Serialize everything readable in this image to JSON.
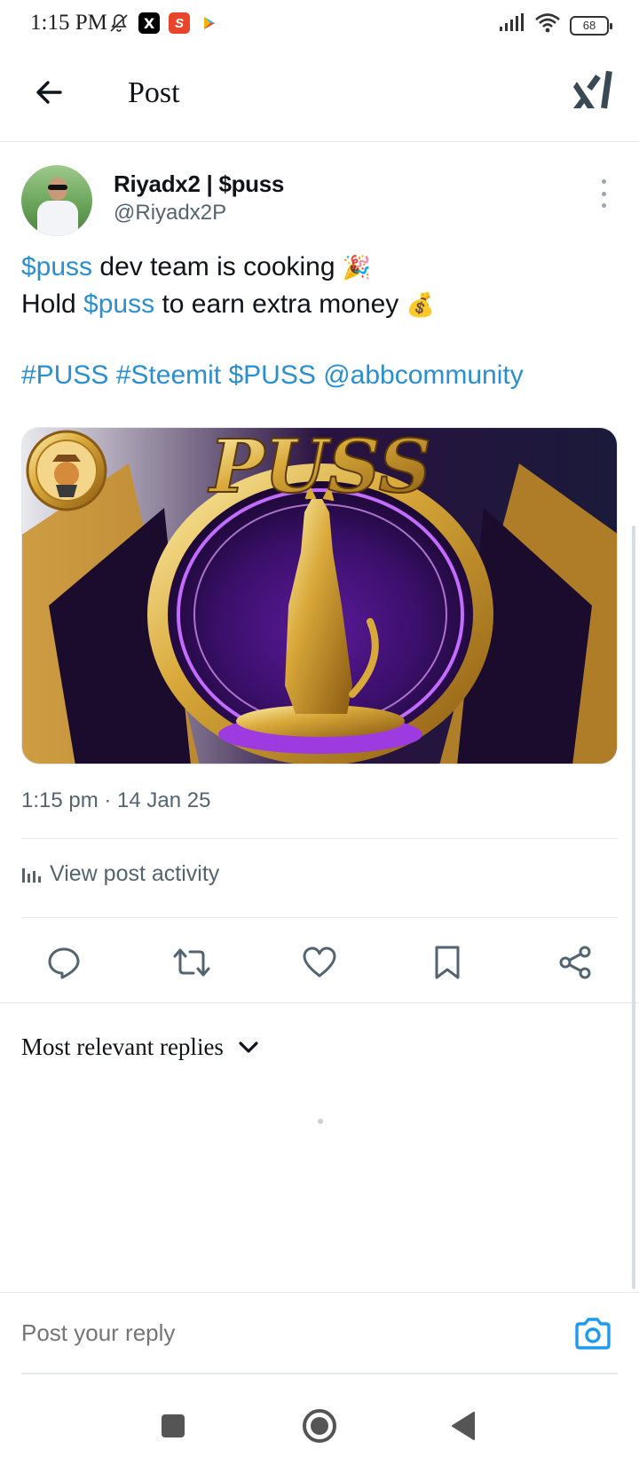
{
  "status_bar": {
    "time": "1:15 PM",
    "battery": "68",
    "icons": [
      "bell-off-icon",
      "x-app-icon",
      "s-app-icon",
      "play-store-icon",
      "signal-icon",
      "wifi-icon",
      "battery-icon"
    ],
    "x_glyph": "X",
    "s_glyph": "S"
  },
  "header": {
    "title": "Post",
    "back_icon": "arrow-left-icon",
    "logo_icon": "xai-logo-icon"
  },
  "post": {
    "author": {
      "name": "Riyadx2 | $puss",
      "handle": "@Riyadx2P"
    },
    "text": {
      "line1": {
        "link": "$puss",
        "rest": " dev team is cooking ",
        "emoji": "🎉"
      },
      "line2": {
        "prefix": "Hold ",
        "link": "$puss",
        "rest": " to earn extra money ",
        "emoji": "💰"
      },
      "tags": [
        "#PUSS",
        "#Steemit",
        "$PUSS",
        "@abbcommunity"
      ]
    },
    "image": {
      "text": "PUSS"
    },
    "timestamp": "1:15 pm · 14 Jan 25",
    "activity_label": "View post activity"
  },
  "actions": [
    "reply-icon",
    "repost-icon",
    "like-icon",
    "bookmark-icon",
    "share-icon"
  ],
  "replies": {
    "sort_label": "Most relevant replies"
  },
  "reply_bar": {
    "placeholder": "Post your reply"
  },
  "colors": {
    "link": "#2a8fd0",
    "secondary_text": "#536471",
    "reply_camera": "#1d9bf0",
    "primary_text": "#0f1419"
  }
}
